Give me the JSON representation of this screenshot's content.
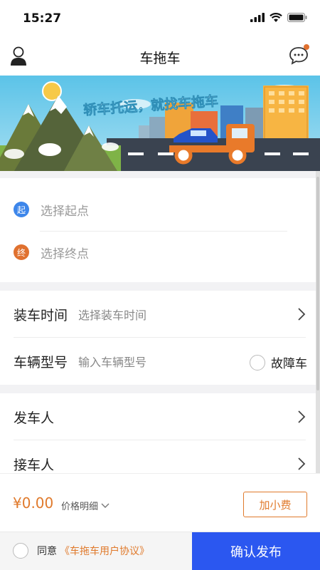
{
  "status_bar": {
    "time": "15:27",
    "icons": [
      "signal-icon",
      "wifi-icon",
      "battery-icon"
    ]
  },
  "nav": {
    "title": "车拖车",
    "left_icon": "user-avatar-icon",
    "right_icon": "chat-icon",
    "notification_dot": true
  },
  "banner": {
    "slogan": "轿车托运，就找车拖车"
  },
  "route": {
    "start": {
      "badge": "起",
      "placeholder": "选择起点",
      "color": "#3d86ea"
    },
    "end": {
      "badge": "终",
      "placeholder": "选择终点",
      "color": "#e0712f"
    }
  },
  "details": {
    "load_time_label": "装车时间",
    "load_time_placeholder": "选择装车时间",
    "vehicle_model_label": "车辆型号",
    "vehicle_model_placeholder": "输入车辆型号",
    "fault_label": "故障车"
  },
  "people": {
    "sender_label": "发车人",
    "receiver_label": "接车人"
  },
  "price": {
    "amount": "¥0.00",
    "detail_label": "价格明细",
    "tip_button": "加小费"
  },
  "footer": {
    "agree_text": "同意",
    "agreement_link": "《车拖车用户协议》",
    "confirm_button": "确认发布"
  },
  "colors": {
    "accent_orange": "#e07a2c",
    "primary_blue": "#2b57f0"
  }
}
